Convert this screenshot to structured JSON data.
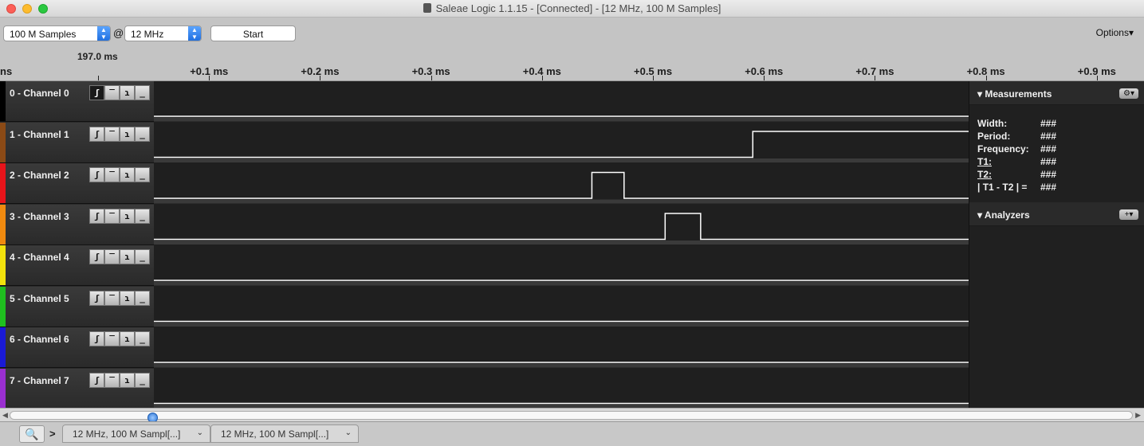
{
  "window": {
    "title": "Saleae Logic 1.1.15 - [Connected] - [12 MHz, 100 M Samples]"
  },
  "toolbar": {
    "samples_value": "100 M Samples",
    "at_sign": "@",
    "rate_value": "12 MHz",
    "start_label": "Start",
    "options_label": "Options▾"
  },
  "ruler": {
    "base_time": "197.0 ms",
    "left_fragment": "ns",
    "ticks": [
      "+0.1 ms",
      "+0.2 ms",
      "+0.3 ms",
      "+0.4 ms",
      "+0.5 ms",
      "+0.6 ms",
      "+0.7 ms",
      "+0.8 ms",
      "+0.9 ms"
    ]
  },
  "channels": [
    {
      "label": "0 - Channel 0",
      "color": "#000000"
    },
    {
      "label": "1 - Channel 1",
      "color": "#8b4a16"
    },
    {
      "label": "2 - Channel 2",
      "color": "#e8141a"
    },
    {
      "label": "3 - Channel 3",
      "color": "#f08a0f"
    },
    {
      "label": "4 - Channel 4",
      "color": "#f2e20c"
    },
    {
      "label": "5 - Channel 5",
      "color": "#1fbf1f"
    },
    {
      "label": "6 - Channel 6",
      "color": "#1a1ad6"
    },
    {
      "label": "7 - Channel 7",
      "color": "#9a2fd0"
    }
  ],
  "trigger_glyphs": [
    "ʃ",
    "‾",
    "ɿ",
    "_"
  ],
  "waveforms": [
    {
      "channel": 0,
      "initial": 0,
      "edges_ms": []
    },
    {
      "channel": 1,
      "initial": 0,
      "edges_ms": [
        0.59
      ]
    },
    {
      "channel": 2,
      "initial": 0,
      "edges_ms": [
        0.445,
        0.474
      ]
    },
    {
      "channel": 3,
      "initial": 0,
      "edges_ms": [
        0.511,
        0.543
      ]
    },
    {
      "channel": 4,
      "initial": 0,
      "edges_ms": []
    },
    {
      "channel": 5,
      "initial": 0,
      "edges_ms": []
    },
    {
      "channel": 6,
      "initial": 0,
      "edges_ms": []
    },
    {
      "channel": 7,
      "initial": 0,
      "edges_ms": []
    }
  ],
  "measurements": {
    "title": "Measurements",
    "gear": "⚙▾",
    "rows": [
      {
        "label": "Width:",
        "value": "###"
      },
      {
        "label": "Period:",
        "value": "###"
      },
      {
        "label": "Frequency:",
        "value": "###"
      },
      {
        "label": "T1:",
        "value": "###"
      },
      {
        "label": "T2:",
        "value": "###"
      },
      {
        "label": "| T1 - T2 | =",
        "value": "###"
      }
    ]
  },
  "analyzers": {
    "title": "Analyzers",
    "add": "+▾"
  },
  "tabs": [
    {
      "label": "12 MHz, 100 M Sampl[...]"
    },
    {
      "label": "12 MHz, 100 M Sampl[...]"
    }
  ],
  "tab_icons": {
    "search": "🔍",
    "arrow": ">"
  },
  "colors": {
    "waveform": "#ffffff",
    "background": "#1f1f1f",
    "accent": "#2b73d4"
  }
}
